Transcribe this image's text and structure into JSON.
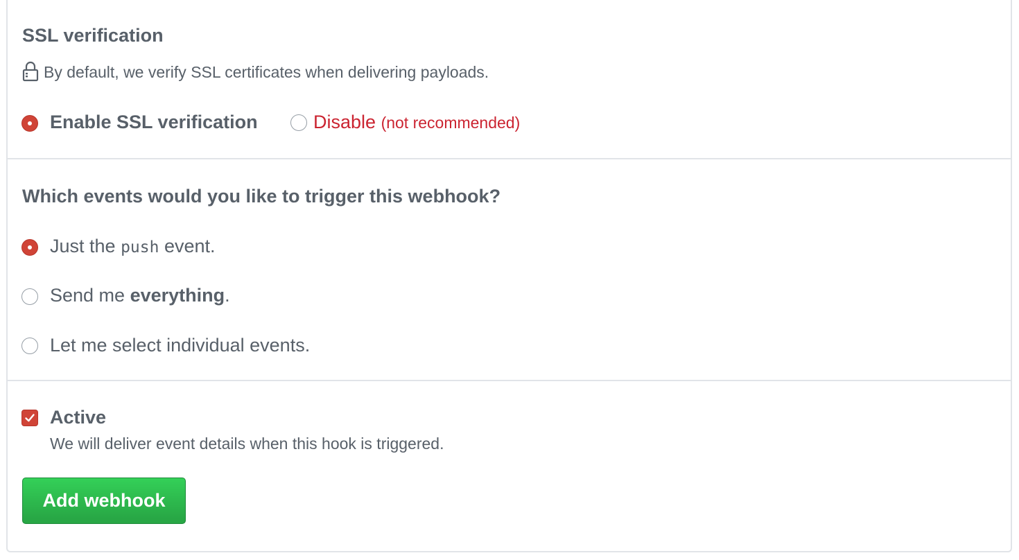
{
  "ssl": {
    "heading": "SSL verification",
    "note": "By default, we verify SSL certificates when delivering payloads.",
    "lock_icon": "lock-icon",
    "enable_label": "Enable SSL verification",
    "enable_checked": true,
    "disable_label": "Disable",
    "disable_note": "(not recommended)",
    "disable_checked": false,
    "warning_color": "#cb2431"
  },
  "events": {
    "heading": "Which events would you like to trigger this webhook?",
    "options": [
      {
        "prefix": "Just the",
        "code": "push",
        "suffix": "event.",
        "checked": true
      },
      {
        "prefix": "Send me",
        "bold": "everything",
        "suffix": ".",
        "checked": false
      },
      {
        "label": "Let me select individual events.",
        "checked": false
      }
    ]
  },
  "active": {
    "label": "Active",
    "checked": true,
    "description": "We will deliver event details when this hook is triggered."
  },
  "submit": {
    "label": "Add webhook",
    "color": "#28a745"
  },
  "accent_color": "#d04437"
}
